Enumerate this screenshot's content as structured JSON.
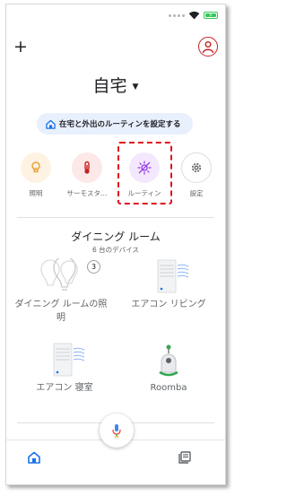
{
  "home": {
    "title": "自宅"
  },
  "chip": {
    "label": "在宅と外出のルーティンを設定する"
  },
  "shortcuts": [
    {
      "label": "照明",
      "icon": "lightbulb-icon",
      "bg": "#fef3e2",
      "color": "#e8a33d"
    },
    {
      "label": "サーモスタ…",
      "icon": "thermometer-icon",
      "bg": "#fce8e6",
      "color": "#c5221f"
    },
    {
      "label": "ルーティン",
      "icon": "routine-icon",
      "bg": "#f3e8fd",
      "color": "#9334e6"
    },
    {
      "label": "設定",
      "icon": "gear-icon",
      "bg": "#ffffff",
      "color": "#5f6368"
    }
  ],
  "room": {
    "title": "ダイニング ルーム",
    "subtitle": "6 台のデバイス",
    "devices": [
      {
        "label": "ダイニング ルームの照明",
        "icon": "light-group-icon",
        "badge": "3"
      },
      {
        "label": "エアコン リビング",
        "icon": "air-conditioner-icon"
      },
      {
        "label": "エアコン 寝室",
        "icon": "air-conditioner-icon"
      },
      {
        "label": "Roomba",
        "icon": "robot-vacuum-icon"
      }
    ]
  },
  "colors": {
    "accent": "#1a73e8",
    "highlight": "#e0101e"
  }
}
